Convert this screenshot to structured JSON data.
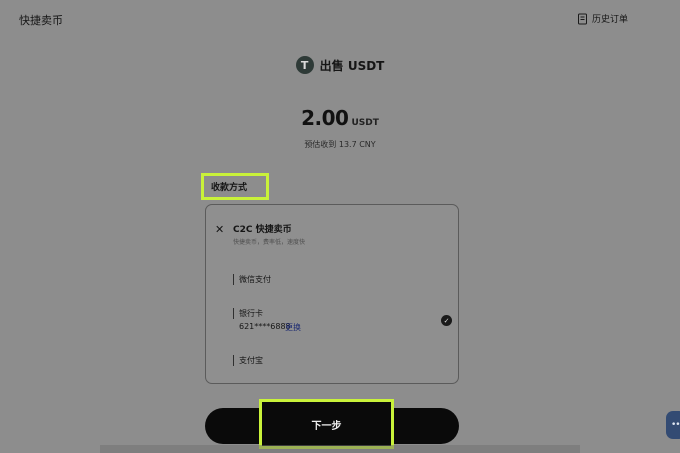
{
  "header": {
    "title": "快捷卖币",
    "history_label": "历史订单",
    "history_icon": "receipt-icon"
  },
  "asset": {
    "icon": "tether-icon",
    "icon_letter": "T",
    "title": "出售 USDT"
  },
  "amount": {
    "value": "2.00",
    "unit": "USDT",
    "estimate": "预估收到 13.7 CNY"
  },
  "payment": {
    "section_label": "收款方式",
    "provider_icon": "c2c-icon",
    "provider_title": "C2C 快捷卖币",
    "provider_subtitle": "快捷卖币，费率低，速度快",
    "methods": [
      {
        "label": "微信支付"
      },
      {
        "label": "银行卡",
        "account": "621****6888",
        "change": "更换",
        "selected": true
      },
      {
        "label": "支付宝"
      }
    ]
  },
  "actions": {
    "next_label": "下一步"
  },
  "colors": {
    "highlight": "#c9f23a",
    "button": "#0a0a0a",
    "chat": "#334b73"
  }
}
